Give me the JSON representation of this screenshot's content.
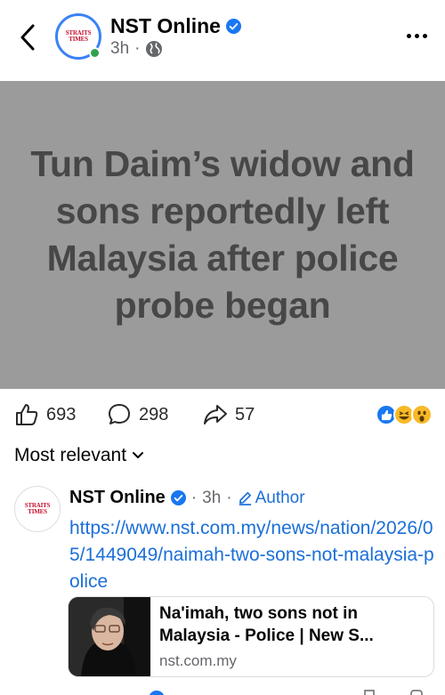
{
  "header": {
    "page_name": "NST Online",
    "timestamp": "3h",
    "separator": "·",
    "avatar_logo_text": "STRAITS TIMES",
    "audience_icon": "globe-icon"
  },
  "post": {
    "headline": "Tun Daim’s widow and sons reportedly left Malaysia after police probe began",
    "image_bg_color": "#9b9b9b"
  },
  "actions": {
    "likes": "693",
    "comments": "298",
    "shares": "57"
  },
  "reactions": [
    "like",
    "haha",
    "wow"
  ],
  "comments_section": {
    "sort_label": "Most relevant"
  },
  "comment": {
    "author": "NST Online",
    "timestamp": "3h",
    "author_badge": "Author",
    "link_text": "https://www.nst.com.my/news/nation/2026/05/1449049/naimah-two-sons-not-malaysia-police",
    "card": {
      "title": "Na'imah, two sons not in Malaysia - Police | New S...",
      "domain": "nst.com.my"
    }
  },
  "colors": {
    "link": "#1b6fd8",
    "verified": "#1877f2",
    "online": "#31a24c"
  }
}
